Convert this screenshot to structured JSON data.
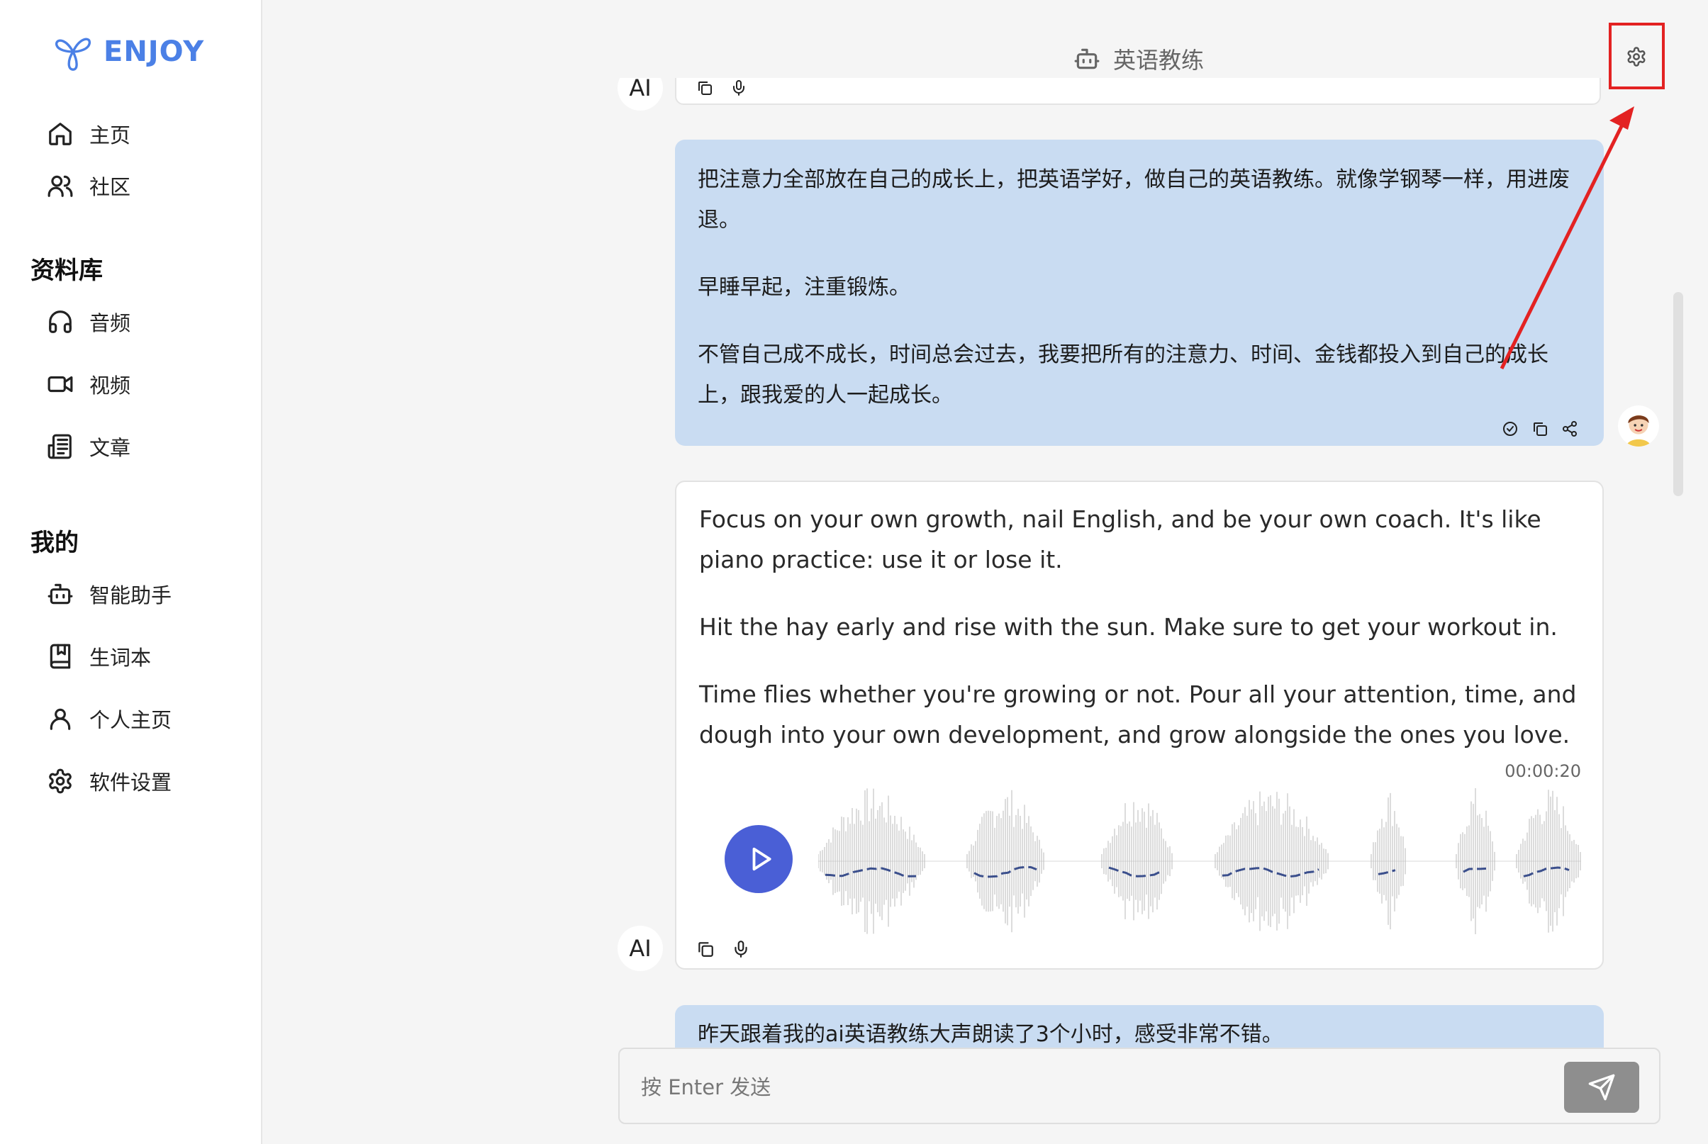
{
  "app": {
    "name": "ENJOY",
    "brand_color": "#4b80e6"
  },
  "sidebar": {
    "nav": [
      {
        "label": "主页",
        "icon": "home-icon"
      },
      {
        "label": "社区",
        "icon": "users-icon"
      }
    ],
    "library": {
      "title": "资料库",
      "items": [
        {
          "label": "音频",
          "icon": "headphones-icon"
        },
        {
          "label": "视频",
          "icon": "video-icon"
        },
        {
          "label": "文章",
          "icon": "newspaper-icon"
        }
      ]
    },
    "mine": {
      "title": "我的",
      "items": [
        {
          "label": "智能助手",
          "icon": "bot-icon"
        },
        {
          "label": "生词本",
          "icon": "bookmark-book-icon"
        },
        {
          "label": "个人主页",
          "icon": "user-icon"
        },
        {
          "label": "软件设置",
          "icon": "settings-icon"
        }
      ]
    }
  },
  "header": {
    "title": "英语教练",
    "icon": "bot-icon"
  },
  "messages": {
    "user_1": {
      "paragraphs": [
        "把注意力全部放在自己的成长上，把英语学好，做自己的英语教练。就像学钢琴一样，用进废退。",
        "早睡早起，注重锻炼。",
        "不管自己成不成长，时间总会过去，我要把所有的注意力、时间、金钱都投入到自己的成长上，跟我爱的人一起成长。"
      ]
    },
    "ai_1": {
      "badge": "AI",
      "paragraphs": [
        "Focus on your own growth, nail English, and be your own coach. It's like piano practice: use it or lose it.",
        "Hit the hay early and rise with the sun. Make sure to get your workout in.",
        "Time flies whether you're growing or not. Pour all your attention, time, and dough into your own development, and grow alongside the ones you love."
      ],
      "duration": "00:00:20"
    },
    "ai_prev": {
      "badge": "AI"
    },
    "user_2": {
      "text": "昨天跟着我的ai英语教练大声朗读了3个小时，感受非常不错。"
    }
  },
  "composer": {
    "placeholder": "按 Enter 发送"
  },
  "colors": {
    "user_bubble": "#c9dcf2",
    "play_button": "#4a5fd6",
    "annotation": "#e32222"
  }
}
